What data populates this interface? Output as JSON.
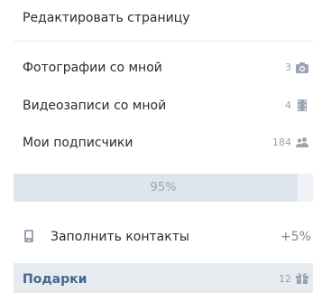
{
  "edit_page": {
    "label": "Редактировать страницу"
  },
  "counters": [
    {
      "label": "Фотографии со мной",
      "count": "3",
      "icon": "camera-icon"
    },
    {
      "label": "Видеозаписи со мной",
      "count": "4",
      "icon": "film-icon"
    },
    {
      "label": "Мои подписчики",
      "count": "184",
      "icon": "people-icon"
    }
  ],
  "profile_progress": {
    "label": "95%",
    "value": 0.95
  },
  "fill_contacts": {
    "label": "Заполнить контакты",
    "bonus": "+5%",
    "icon": "phone-icon"
  },
  "gifts": {
    "title": "Подарки",
    "count": "12",
    "icon": "gift-icon"
  },
  "colors": {
    "text": "#2b2b2b",
    "muted": "#9aa3ad",
    "icon": "#9aa5b3",
    "header_bg": "#e6ebf0",
    "header_text": "#45678f",
    "progress_bg": "#eef1f5",
    "progress_fill": "#dfe5ec"
  }
}
